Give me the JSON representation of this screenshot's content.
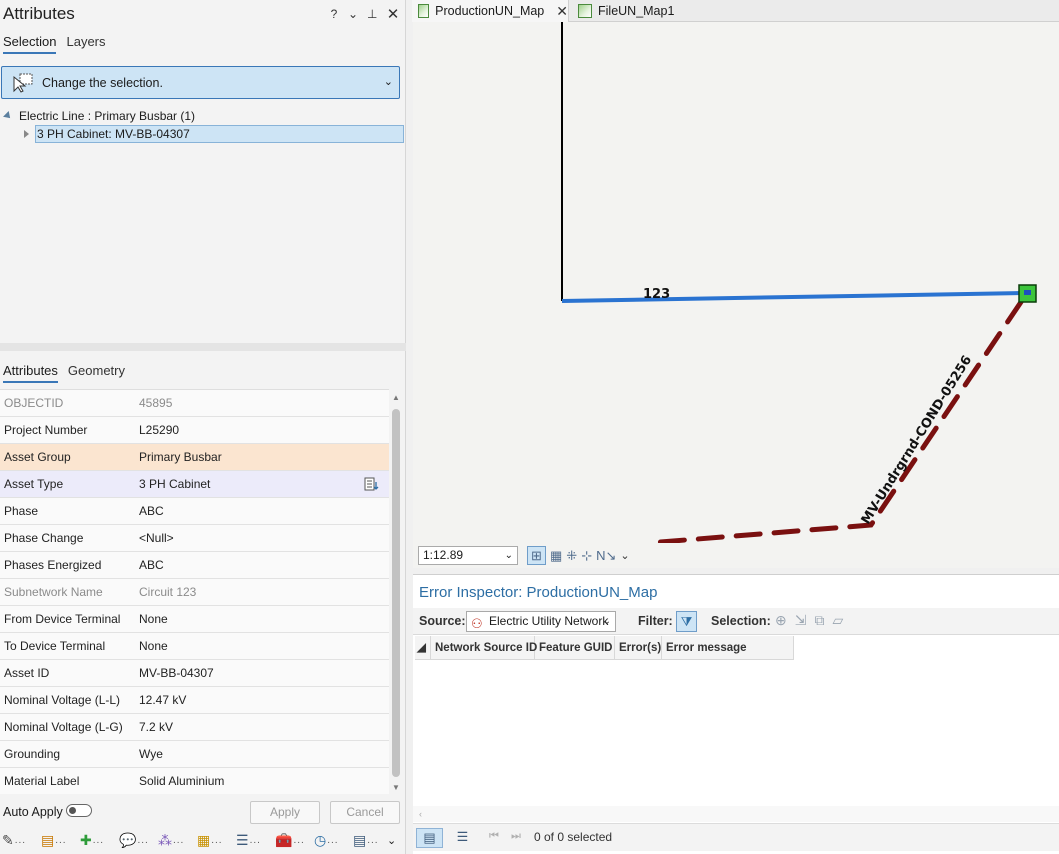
{
  "attributes_pane": {
    "title": "Attributes",
    "controls": {
      "help": "?",
      "menu": "⌄",
      "pin": "⊥",
      "close": "✕"
    },
    "tabs": [
      {
        "label": "Selection",
        "active": true
      },
      {
        "label": "Layers",
        "active": false
      }
    ],
    "selection_hint": "Change the selection.",
    "tree": {
      "group_label": "Electric Line : Primary Busbar (1)",
      "selected_item": "3 PH Cabinet: MV-BB-04307"
    },
    "detail_tabs": [
      {
        "label": "Attributes",
        "active": true
      },
      {
        "label": "Geometry",
        "active": false
      }
    ],
    "rows": [
      {
        "field": "OBJECTID",
        "value": "45895",
        "style": "dim"
      },
      {
        "field": "Project Number",
        "value": "L25290",
        "style": "normal"
      },
      {
        "field": "Asset Group",
        "value": "Primary Busbar",
        "style": "orange"
      },
      {
        "field": "Asset Type",
        "value": "3 PH Cabinet",
        "style": "purple"
      },
      {
        "field": "Phase",
        "value": "ABC",
        "style": "normal"
      },
      {
        "field": "Phase Change",
        "value": "<Null>",
        "style": "normal"
      },
      {
        "field": "Phases Energized",
        "value": "ABC",
        "style": "normal"
      },
      {
        "field": "Subnetwork Name",
        "value": "Circuit 123",
        "style": "dim"
      },
      {
        "field": "From Device Terminal",
        "value": "None",
        "style": "normal"
      },
      {
        "field": "To Device Terminal",
        "value": "None",
        "style": "normal"
      },
      {
        "field": "Asset ID",
        "value": "MV-BB-04307",
        "style": "normal"
      },
      {
        "field": "Nominal Voltage (L-L)",
        "value": "12.47 kV",
        "style": "normal"
      },
      {
        "field": "Nominal Voltage (L-G)",
        "value": "7.2 kV",
        "style": "normal"
      },
      {
        "field": "Grounding",
        "value": "Wye",
        "style": "normal"
      },
      {
        "field": "Material Label",
        "value": "Solid Aluminium",
        "style": "normal"
      }
    ],
    "auto_apply_label": "Auto Apply",
    "auto_apply_on": false,
    "apply_label": "Apply",
    "cancel_label": "Cancel"
  },
  "documents": {
    "tabs": [
      {
        "label": "ProductionUN_Map",
        "active": true
      },
      {
        "label": "FileUN_Map1",
        "active": false
      }
    ]
  },
  "map": {
    "line_label": "123",
    "conductor_label": "MV-Undrgrnd-COND-05256",
    "scale": "1:12.89",
    "colors": {
      "busbar": "#2a73d1",
      "conductor": "#7a1010",
      "device": "#3cc43c"
    }
  },
  "error_inspector": {
    "title": "Error Inspector: ProductionUN_Map",
    "source_label": "Source:",
    "source_value": "Electric Utility Network",
    "filter_label": "Filter:",
    "selection_label": "Selection:",
    "columns": [
      "Network Source ID",
      "Feature GUID",
      "Error(s)",
      "Error message"
    ],
    "rows": [],
    "status": "0 of 0 selected"
  }
}
